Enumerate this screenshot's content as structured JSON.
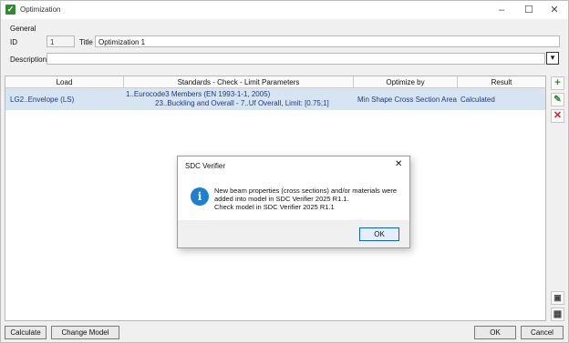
{
  "window": {
    "title": "Optimization"
  },
  "general": {
    "group_label": "General",
    "id_label": "ID",
    "id_value": "1",
    "title_label": "Title",
    "title_value": "Optimization 1",
    "description_label": "Description",
    "description_value": ""
  },
  "table": {
    "headers": [
      "Load",
      "Standards - Check - Limit Parameters",
      "Optimize by",
      "Result"
    ],
    "rows": [
      {
        "load": "LG2..Envelope (LS)",
        "standards_line1": "1..Eurocode3 Members (EN 1993-1-1, 2005)",
        "standards_line2": "23..Buckling and Overall - 7..Uf Overall, Limit: [0.75;1]",
        "optimize_by": "Min Shape Cross Section Area",
        "result": "Calculated"
      }
    ]
  },
  "side_buttons": [
    "add-icon",
    "edit-icon",
    "delete-icon",
    "monitor-icon",
    "table-icon"
  ],
  "buttons": {
    "calculate": "Calculate",
    "change_model": "Change Model",
    "ok": "OK",
    "cancel": "Cancel"
  },
  "dialog": {
    "title": "SDC Verifier",
    "message_line1": "New beam properties (cross sections) and/or materials were",
    "message_line2": "added into model in SDC Verifier 2025 R1.1.",
    "message_line3": "Check model in SDC Verifier 2025 R1.1",
    "ok": "OK"
  },
  "colors": {
    "row_selected": "#d7e4f2",
    "info": "#1e7fd0",
    "add": "#2e8b2e",
    "delete": "#cc2222"
  }
}
